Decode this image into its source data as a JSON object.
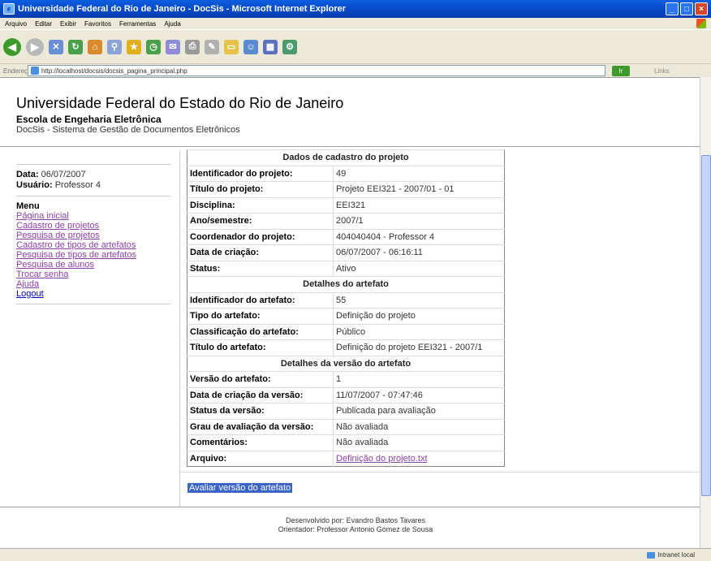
{
  "window": {
    "title": "Universidade Federal do Rio de Janeiro - DocSis - Microsoft Internet Explorer"
  },
  "menubar": [
    "Arquivo",
    "Editar",
    "Exibir",
    "Favoritos",
    "Ferramentas",
    "Ajuda"
  ],
  "address": {
    "label": "Endereço",
    "url": "http://localhost/docsis/docsis_pagina_principal.php",
    "go": "Ir",
    "links": "Links"
  },
  "header": {
    "university": "Universidade Federal do Estado do Rio de Janeiro",
    "school": "Escola de Engeharia Eletrônica",
    "system": "DocSis - Sistema de Gestão de Documentos Eletrônicos"
  },
  "sidebar": {
    "date_label": "Data:",
    "date_value": "06/07/2007",
    "user_label": "Usuário:",
    "user_value": "Professor 4",
    "menu_title": "Menu",
    "links": [
      "Página inicial",
      "Cadastro de projetos",
      "Pesquisa de projetos",
      "Cadastro de tipos de artefatos",
      "Pesquisa de tipos de artefatos",
      "Pesquisa de alunos",
      "Trocar senha",
      "Ajuda",
      "Logout"
    ]
  },
  "details": {
    "section1": "Dados de cadastro do projeto",
    "project_id_label": "Identificador do projeto:",
    "project_id": "49",
    "project_title_label": "Título do projeto:",
    "project_title": "Projeto EEI321 - 2007/01 - 01",
    "discipline_label": "Disciplina:",
    "discipline": "EEI321",
    "semester_label": "Ano/semestre:",
    "semester": "2007/1",
    "coordinator_label": "Coordenador do projeto:",
    "coordinator": "404040404 - Professor 4",
    "creation_label": "Data de criação:",
    "creation": "06/07/2007 - 06:16:11",
    "status_label": "Status:",
    "status": "Ativo",
    "section2": "Detalhes do artefato",
    "artifact_id_label": "Identificador do artefato:",
    "artifact_id": "55",
    "artifact_type_label": "Tipo do artefato:",
    "artifact_type": "Definição do projeto",
    "classification_label": "Classificação do artefato:",
    "classification": "Público",
    "artifact_title_label": "Título do artefato:",
    "artifact_title": "Definição do projeto EEI321 - 2007/1",
    "section3": "Detalhes da versão do artefato",
    "version_label": "Versão do artefato:",
    "version": "1",
    "version_date_label": "Data de criação da versão:",
    "version_date": "11/07/2007 - 07:47:46",
    "version_status_label": "Status da versão:",
    "version_status": "Publicada para avaliação",
    "grade_label": "Grau de avaliação da versão:",
    "grade": "Não avaliada",
    "comments_label": "Comentários:",
    "comments": "Não avaliada",
    "file_label": "Arquivo:",
    "file": "Definição do projeto.txt"
  },
  "action": {
    "evaluate": "Avaliar versão do artefato"
  },
  "footer": {
    "line1": "Desenvolvido por: Evandro Bastos Tavares",
    "line2": "Orientador: Professor Antonio Gomez de Sousa"
  },
  "statusbar": {
    "zone": "Intranet local"
  }
}
